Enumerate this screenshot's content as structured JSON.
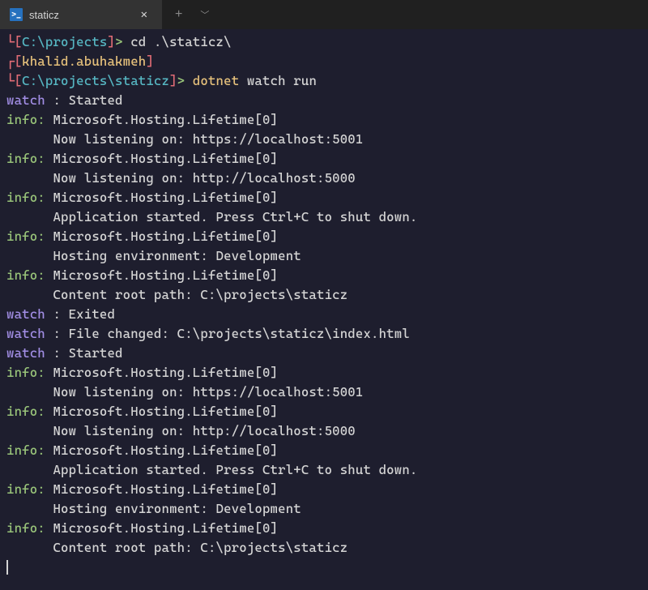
{
  "tab": {
    "title": "staticz",
    "icon_glyph": ">_"
  },
  "prompt1": {
    "corner_l": "└",
    "lb": "[",
    "path": "C:\\projects",
    "rb": "]",
    "gt": "> ",
    "cmd": "cd .\\staticz\\"
  },
  "prompt2_top": {
    "corner_r": "┌",
    "lb": "[",
    "user": "khalid.abuhakmeh",
    "rb": "]"
  },
  "prompt2": {
    "corner_l": "└",
    "lb": "[",
    "path": "C:\\projects\\staticz",
    "rb": "]",
    "gt": "> ",
    "cmd1": "dotnet",
    "cmd2": " watch run"
  },
  "watch_label": "watch ",
  "colon": ": ",
  "watch_started": "Started",
  "watch_exited": "Exited",
  "watch_filechanged": "File changed: C:\\projects\\staticz\\index.html",
  "info_prefix": "info: ",
  "info_source": "Microsoft.Hosting.Lifetime[0]",
  "indent": "      ",
  "msg_listen_https": "Now listening on: https://localhost:5001",
  "msg_listen_http": "Now listening on: http://localhost:5000",
  "msg_app_started": "Application started. Press Ctrl+C to shut down.",
  "msg_env": "Hosting environment: Development",
  "msg_root": "Content root path: C:\\projects\\staticz"
}
